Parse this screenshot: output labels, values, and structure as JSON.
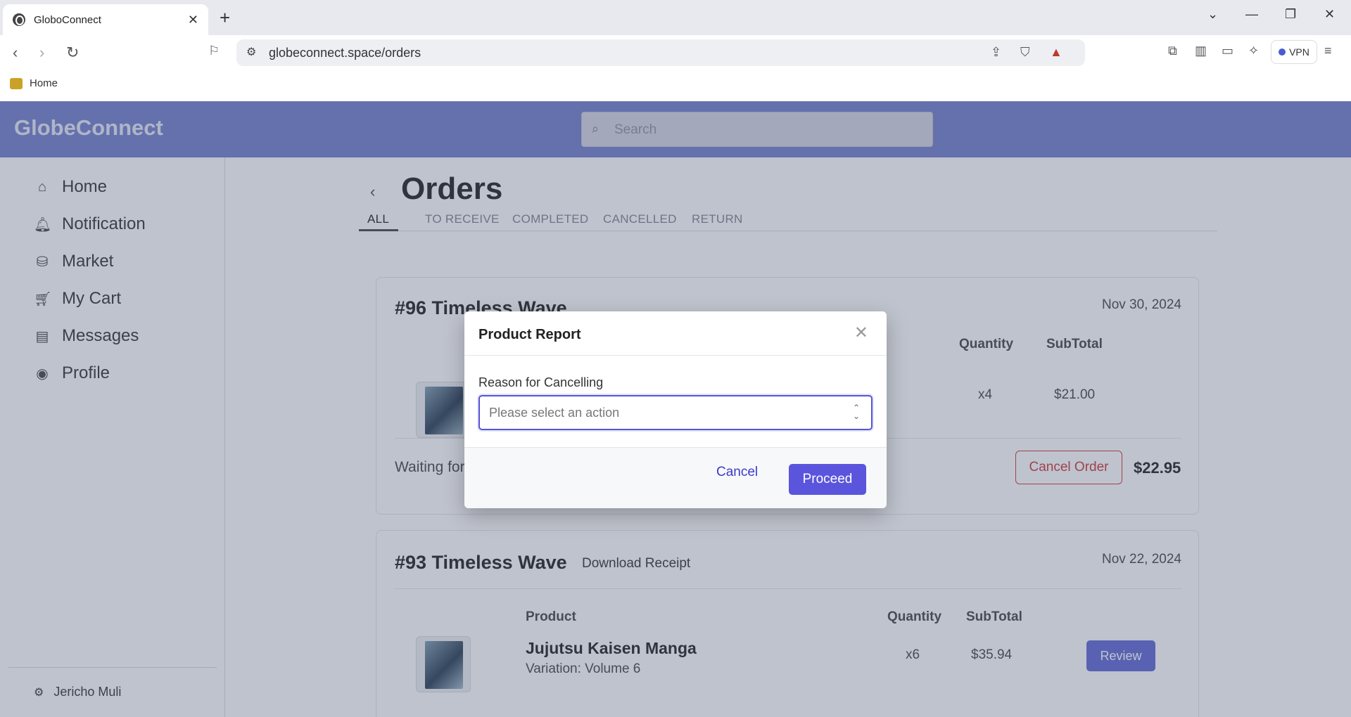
{
  "browser": {
    "tab_title": "GloboConnect",
    "url": "globeconnect.space/orders",
    "vpn_label": "VPN",
    "bookmark_home": "Home"
  },
  "app": {
    "brand": "GlobeConnect",
    "search_placeholder": "Search"
  },
  "sidebar": {
    "items": [
      {
        "label": "Home",
        "icon": "home-icon"
      },
      {
        "label": "Notification",
        "icon": "bell-icon"
      },
      {
        "label": "Market",
        "icon": "bag-icon"
      },
      {
        "label": "My Cart",
        "icon": "cart-icon"
      },
      {
        "label": "Messages",
        "icon": "message-icon"
      },
      {
        "label": "Profile",
        "icon": "profile-icon"
      }
    ],
    "user_name": "Jericho Muli"
  },
  "orders": {
    "title": "Orders",
    "tabs": [
      "ALL",
      "TO RECEIVE",
      "COMPLETED",
      "CANCELLED",
      "RETURN"
    ],
    "active_tab": "ALL",
    "cards": [
      {
        "title": "#96 Timeless Wave",
        "date": "Nov 30, 2024",
        "col_quantity": "Quantity",
        "col_subtotal": "SubTotal",
        "quantity": "x4",
        "subtotal": "$21.00",
        "status": "Waiting for",
        "action": "Cancel Order",
        "total": "$22.95"
      },
      {
        "title": "#93 Timeless Wave",
        "receipt": "Download Receipt",
        "date": "Nov 22, 2024",
        "col_product": "Product",
        "col_quantity": "Quantity",
        "col_subtotal": "SubTotal",
        "product_name": "Jujutsu Kaisen Manga",
        "variation": "Variation: Volume 6",
        "quantity": "x6",
        "subtotal": "$35.94",
        "action": "Review"
      }
    ]
  },
  "modal": {
    "title": "Product Report",
    "field_label": "Reason for Cancelling",
    "select_placeholder": "Please select an action",
    "cancel_label": "Cancel",
    "proceed_label": "Proceed"
  },
  "colors": {
    "appbar": "#7e8ad2",
    "primary": "#5a55dc",
    "danger": "#d04a4a"
  }
}
